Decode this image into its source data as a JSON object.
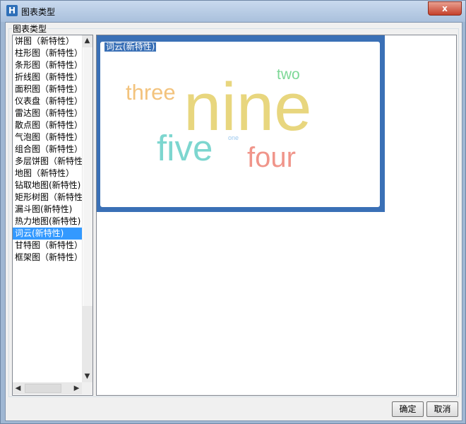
{
  "window": {
    "title": "图表类型",
    "close_glyph": "x",
    "app_icon": "H"
  },
  "group": {
    "label": "图表类型"
  },
  "chart_types": [
    "饼图（新特性）",
    "柱形图（新特性）",
    "条形图（新特性）",
    "折线图（新特性）",
    "面积图（新特性）",
    "仪表盘（新特性）",
    "雷达图（新特性）",
    "散点图（新特性）",
    "气泡图（新特性）",
    "组合图（新特性）",
    "多层饼图（新特性）",
    "地图（新特性）",
    "钻取地图(新特性)",
    "矩形树图（新特性）",
    "漏斗图(新特性)",
    "热力地图(新特性)",
    "词云(新特性)",
    "甘特图（新特性）",
    "框架图（新特性）"
  ],
  "selected_index": 16,
  "preview": {
    "caption": "词云(新特性)",
    "words": [
      {
        "text": "nine",
        "color": "#e8d67e"
      },
      {
        "text": "three",
        "color": "#f3c37d"
      },
      {
        "text": "two",
        "color": "#7dd896"
      },
      {
        "text": "five",
        "color": "#7dd6cf"
      },
      {
        "text": "four",
        "color": "#f0958a"
      },
      {
        "text": "one",
        "color": "#9ec9ee"
      }
    ]
  },
  "buttons": {
    "ok": "确定",
    "cancel": "取消"
  },
  "scroll_icons": {
    "up": "▲",
    "down": "▼",
    "left": "◀",
    "right": "▶"
  }
}
